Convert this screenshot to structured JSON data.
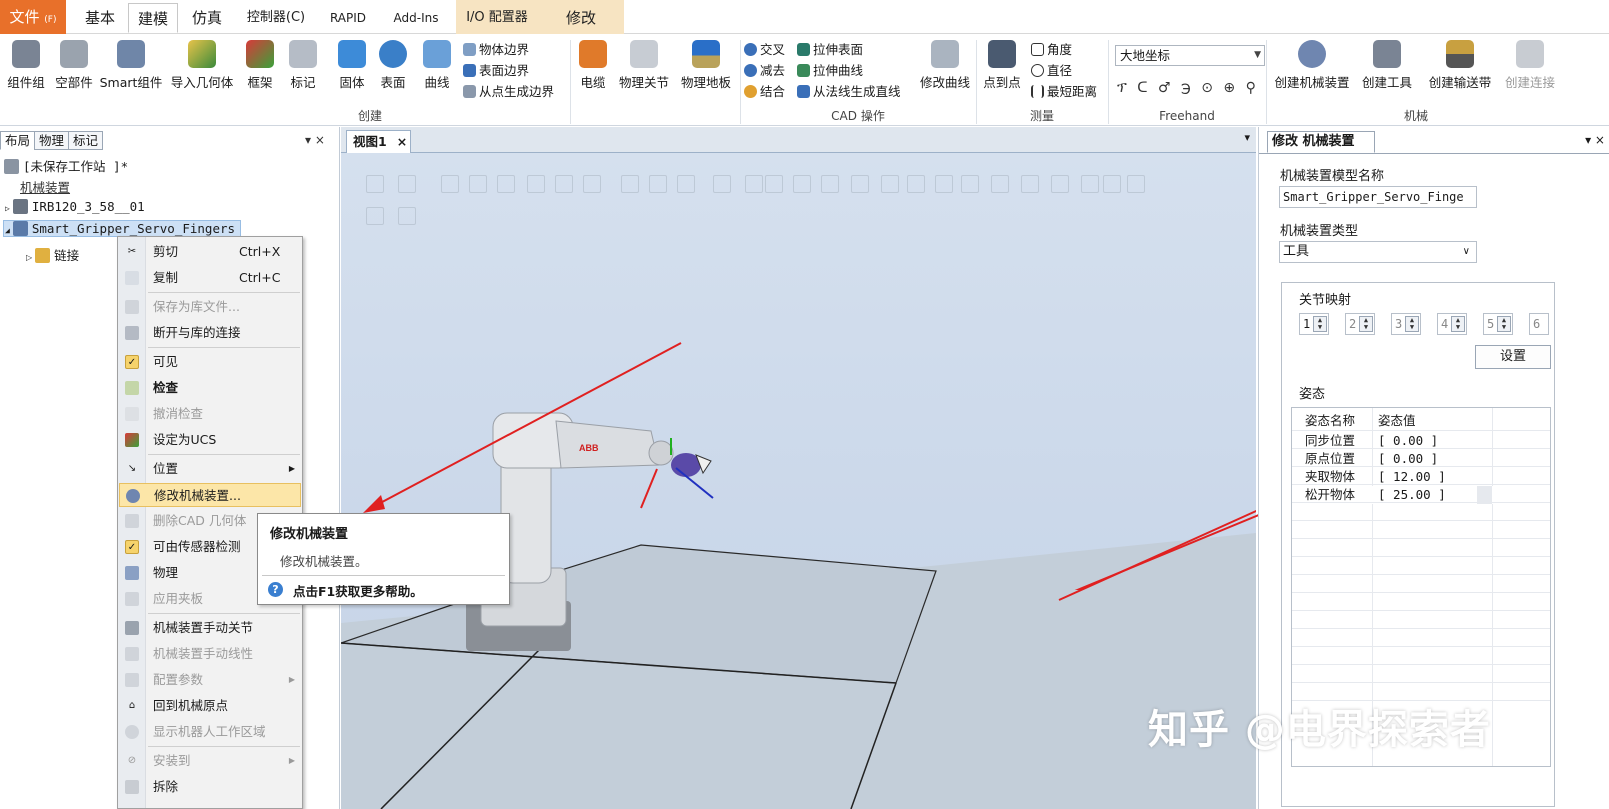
{
  "menu": {
    "file": "文件",
    "file_key": "(F)",
    "tabs": [
      "基本",
      "建模",
      "仿真",
      "控制器(C)",
      "RAPID",
      "Add-Ins",
      "I/O 配置器",
      "修改"
    ]
  },
  "ribbon": {
    "create_buttons": [
      "组件组",
      "空部件",
      "Smart组件",
      "导入几何体",
      "框架",
      "标记"
    ],
    "model_buttons": [
      "固体",
      "表面",
      "曲线"
    ],
    "boundary": [
      "物体边界",
      "表面边界",
      "从点生成边界"
    ],
    "cable_buttons": [
      "电缆",
      "物理关节",
      "物理地板"
    ],
    "cad_left": [
      "交叉",
      "减去",
      "结合"
    ],
    "cad_right": [
      "拉伸表面",
      "拉伸曲线",
      "从法线生成直线"
    ],
    "modify_curve": "修改曲线",
    "point_to_point": "点到点",
    "measure": [
      "角度",
      "直径",
      "最短距离"
    ],
    "coordinate": "大地坐标",
    "mech_buttons": [
      "创建机械装置",
      "创建工具",
      "创建输送带",
      "创建连接"
    ],
    "groups": [
      "创建",
      "CAD 操作",
      "测量",
      "Freehand",
      "机械"
    ]
  },
  "left_panel": {
    "tabs": [
      "布局",
      "物理",
      "标记"
    ],
    "controls": "▾ ×",
    "tree": {
      "station": "[未保存工作站 ]*",
      "mechanisms": "机械装置",
      "robot": "IRB120_3_58__01",
      "gripper": "Smart_Gripper_Servo_Fingers",
      "links": "链接"
    }
  },
  "context_menu": {
    "items": [
      {
        "label": "剪切",
        "shortcut": "Ctrl+X"
      },
      {
        "label": "复制",
        "shortcut": "Ctrl+C"
      },
      {
        "label": "保存为库文件..."
      },
      {
        "label": "断开与库的连接"
      },
      {
        "label": "可见"
      },
      {
        "label": "检查"
      },
      {
        "label": "撤消检查"
      },
      {
        "label": "设定为UCS"
      },
      {
        "label": "位置"
      },
      {
        "label": "修改机械装置..."
      },
      {
        "label": "删除CAD 几何体"
      },
      {
        "label": "可由传感器检测"
      },
      {
        "label": "物理"
      },
      {
        "label": "应用夹板"
      },
      {
        "label": "机械装置手动关节"
      },
      {
        "label": "机械装置手动线性"
      },
      {
        "label": "配置参数"
      },
      {
        "label": "回到机械原点"
      },
      {
        "label": "显示机器人工作区域"
      },
      {
        "label": "安装到"
      },
      {
        "label": "拆除"
      }
    ]
  },
  "tooltip": {
    "title": "修改机械装置",
    "description": "修改机械装置。",
    "help": "点击F1获取更多帮助。"
  },
  "viewport": {
    "tab": "视图1",
    "close": "×",
    "panel_arrow": "▾",
    "robot_logo": "ABB"
  },
  "right_panel": {
    "tab": "修改 机械装置",
    "controls": "▾ ×",
    "model_name_label": "机械装置模型名称",
    "model_name_value": "Smart_Gripper_Servo_Finge",
    "type_label": "机械装置类型",
    "type_value": "工具",
    "joint_mapping_label": "关节映射",
    "joints": [
      "1",
      "2",
      "3",
      "4",
      "5",
      "6"
    ],
    "set_button": "设置",
    "pose_label": "姿态",
    "pose_headers": [
      "姿态名称",
      "姿态值"
    ],
    "poses": [
      {
        "name": "同步位置",
        "value": "[ 0.00 ]"
      },
      {
        "name": "原点位置",
        "value": "[ 0.00 ]"
      },
      {
        "name": "夹取物体",
        "value": "[ 12.00 ]"
      },
      {
        "name": "松开物体",
        "value": "[ 25.00 ]"
      }
    ]
  },
  "watermark": "知乎 @电界探索者",
  "colors": {
    "file_tab": "#e8702a",
    "viewport_bg": "#cbd8ea",
    "highlight": "#fce6a8",
    "annotation_arrow": "#e02020"
  }
}
